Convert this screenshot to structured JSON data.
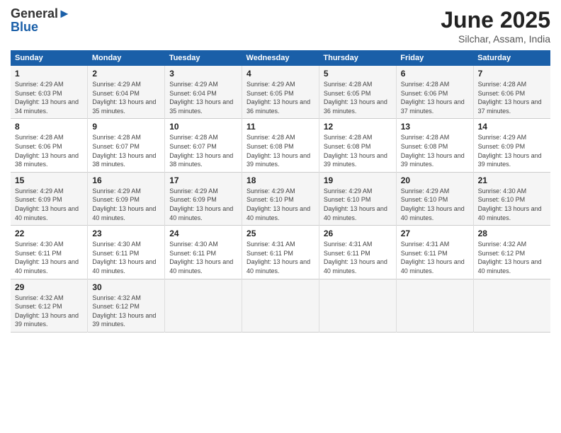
{
  "header": {
    "logo_line1": "General",
    "logo_line2": "Blue",
    "title": "June 2025",
    "subtitle": "Silchar, Assam, India"
  },
  "weekdays": [
    "Sunday",
    "Monday",
    "Tuesday",
    "Wednesday",
    "Thursday",
    "Friday",
    "Saturday"
  ],
  "weeks": [
    [
      {
        "day": "1",
        "rise": "4:29 AM",
        "set": "6:03 PM",
        "hours": "13 hours and 34 minutes."
      },
      {
        "day": "2",
        "rise": "4:29 AM",
        "set": "6:04 PM",
        "hours": "13 hours and 35 minutes."
      },
      {
        "day": "3",
        "rise": "4:29 AM",
        "set": "6:04 PM",
        "hours": "13 hours and 35 minutes."
      },
      {
        "day": "4",
        "rise": "4:29 AM",
        "set": "6:05 PM",
        "hours": "13 hours and 36 minutes."
      },
      {
        "day": "5",
        "rise": "4:28 AM",
        "set": "6:05 PM",
        "hours": "13 hours and 36 minutes."
      },
      {
        "day": "6",
        "rise": "4:28 AM",
        "set": "6:06 PM",
        "hours": "13 hours and 37 minutes."
      },
      {
        "day": "7",
        "rise": "4:28 AM",
        "set": "6:06 PM",
        "hours": "13 hours and 37 minutes."
      }
    ],
    [
      {
        "day": "8",
        "rise": "4:28 AM",
        "set": "6:06 PM",
        "hours": "13 hours and 38 minutes."
      },
      {
        "day": "9",
        "rise": "4:28 AM",
        "set": "6:07 PM",
        "hours": "13 hours and 38 minutes."
      },
      {
        "day": "10",
        "rise": "4:28 AM",
        "set": "6:07 PM",
        "hours": "13 hours and 38 minutes."
      },
      {
        "day": "11",
        "rise": "4:28 AM",
        "set": "6:08 PM",
        "hours": "13 hours and 39 minutes."
      },
      {
        "day": "12",
        "rise": "4:28 AM",
        "set": "6:08 PM",
        "hours": "13 hours and 39 minutes."
      },
      {
        "day": "13",
        "rise": "4:28 AM",
        "set": "6:08 PM",
        "hours": "13 hours and 39 minutes."
      },
      {
        "day": "14",
        "rise": "4:29 AM",
        "set": "6:09 PM",
        "hours": "13 hours and 39 minutes."
      }
    ],
    [
      {
        "day": "15",
        "rise": "4:29 AM",
        "set": "6:09 PM",
        "hours": "13 hours and 40 minutes."
      },
      {
        "day": "16",
        "rise": "4:29 AM",
        "set": "6:09 PM",
        "hours": "13 hours and 40 minutes."
      },
      {
        "day": "17",
        "rise": "4:29 AM",
        "set": "6:09 PM",
        "hours": "13 hours and 40 minutes."
      },
      {
        "day": "18",
        "rise": "4:29 AM",
        "set": "6:10 PM",
        "hours": "13 hours and 40 minutes."
      },
      {
        "day": "19",
        "rise": "4:29 AM",
        "set": "6:10 PM",
        "hours": "13 hours and 40 minutes."
      },
      {
        "day": "20",
        "rise": "4:29 AM",
        "set": "6:10 PM",
        "hours": "13 hours and 40 minutes."
      },
      {
        "day": "21",
        "rise": "4:30 AM",
        "set": "6:10 PM",
        "hours": "13 hours and 40 minutes."
      }
    ],
    [
      {
        "day": "22",
        "rise": "4:30 AM",
        "set": "6:11 PM",
        "hours": "13 hours and 40 minutes."
      },
      {
        "day": "23",
        "rise": "4:30 AM",
        "set": "6:11 PM",
        "hours": "13 hours and 40 minutes."
      },
      {
        "day": "24",
        "rise": "4:30 AM",
        "set": "6:11 PM",
        "hours": "13 hours and 40 minutes."
      },
      {
        "day": "25",
        "rise": "4:31 AM",
        "set": "6:11 PM",
        "hours": "13 hours and 40 minutes."
      },
      {
        "day": "26",
        "rise": "4:31 AM",
        "set": "6:11 PM",
        "hours": "13 hours and 40 minutes."
      },
      {
        "day": "27",
        "rise": "4:31 AM",
        "set": "6:11 PM",
        "hours": "13 hours and 40 minutes."
      },
      {
        "day": "28",
        "rise": "4:32 AM",
        "set": "6:12 PM",
        "hours": "13 hours and 40 minutes."
      }
    ],
    [
      {
        "day": "29",
        "rise": "4:32 AM",
        "set": "6:12 PM",
        "hours": "13 hours and 39 minutes."
      },
      {
        "day": "30",
        "rise": "4:32 AM",
        "set": "6:12 PM",
        "hours": "13 hours and 39 minutes."
      },
      null,
      null,
      null,
      null,
      null
    ]
  ],
  "labels": {
    "sunrise": "Sunrise:",
    "sunset": "Sunset:",
    "daylight": "Daylight:"
  }
}
